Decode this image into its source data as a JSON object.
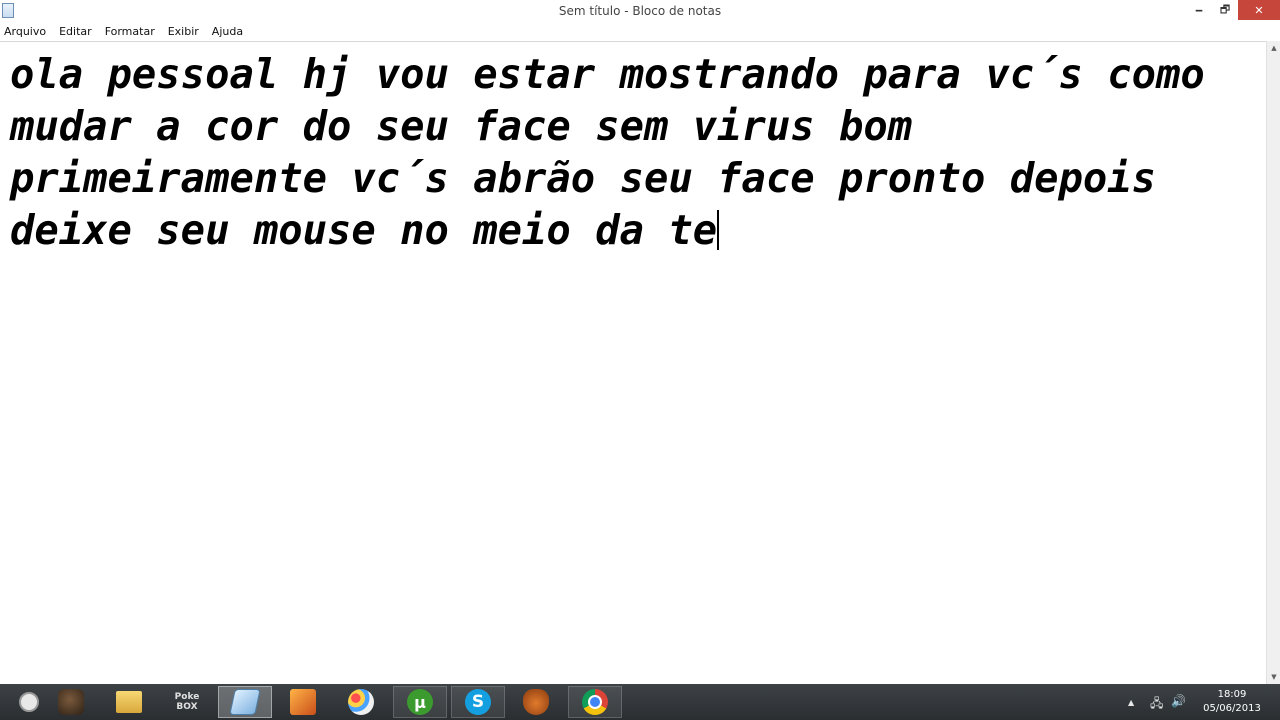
{
  "window": {
    "title": "Sem título - Bloco de notas",
    "controls": {
      "minimize": "🗕",
      "maximize": "🗗",
      "close": "✕"
    }
  },
  "menu": {
    "items": [
      "Arquivo",
      "Editar",
      "Formatar",
      "Exibir",
      "Ajuda"
    ]
  },
  "editor": {
    "content": "ola pessoal hj vou estar mostrando para vc´s como\nmudar a cor do seu face sem virus bom\nprimeiramente vc´s abrão seu face pronto depois\ndeixe seu mouse no meio da te"
  },
  "scrollbar": {
    "up": "▲",
    "down": "▼"
  },
  "taskbar": {
    "apps": [
      {
        "name": "start-button",
        "icon": "start-orb"
      },
      {
        "name": "game-app",
        "icon": "game-icon"
      },
      {
        "name": "file-explorer",
        "icon": "folder-icon"
      },
      {
        "name": "pokebox",
        "icon": "pokebox-icon",
        "label": "Poke BOX"
      },
      {
        "name": "notepad",
        "icon": "notepad-icon",
        "active": true
      },
      {
        "name": "media-player",
        "icon": "media-icon"
      },
      {
        "name": "paint",
        "icon": "paint-icon"
      },
      {
        "name": "utorrent",
        "icon": "utorrent-icon",
        "glyph": "µ"
      },
      {
        "name": "skype",
        "icon": "skype-icon",
        "glyph": "S"
      },
      {
        "name": "glove-app",
        "icon": "glove-icon"
      },
      {
        "name": "chrome",
        "icon": "chrome-icon"
      }
    ],
    "tray": {
      "show_hidden": "▲",
      "network": "🖧",
      "volume": "🔊",
      "time": "18:09",
      "date": "05/06/2013"
    }
  }
}
